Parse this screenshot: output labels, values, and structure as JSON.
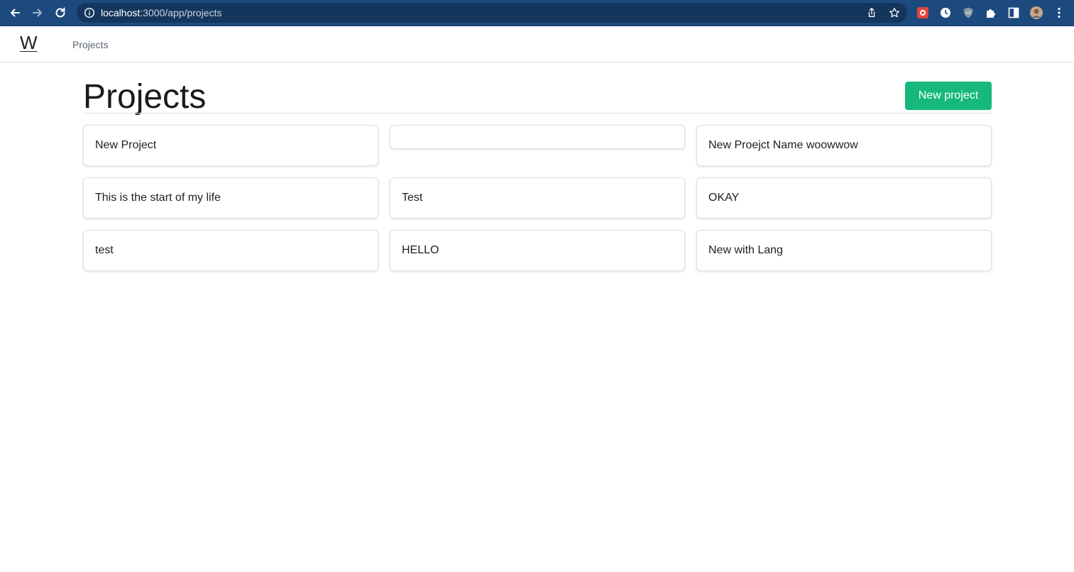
{
  "browser": {
    "url_host": "localhost",
    "url_path": ":3000/app/projects"
  },
  "app": {
    "logo": "W",
    "nav": {
      "projects_label": "Projects"
    }
  },
  "page": {
    "title": "Projects",
    "new_button_label": "New project"
  },
  "projects": [
    {
      "name": "New Project"
    },
    {
      "name": ""
    },
    {
      "name": "New Proejct Name woowwow"
    },
    {
      "name": "This is the start of my life"
    },
    {
      "name": "Test"
    },
    {
      "name": "OKAY"
    },
    {
      "name": "test"
    },
    {
      "name": "HELLO"
    },
    {
      "name": "New with Lang"
    }
  ],
  "colors": {
    "chrome_bg": "#1c4a7e",
    "accent_button": "#16b97b"
  }
}
